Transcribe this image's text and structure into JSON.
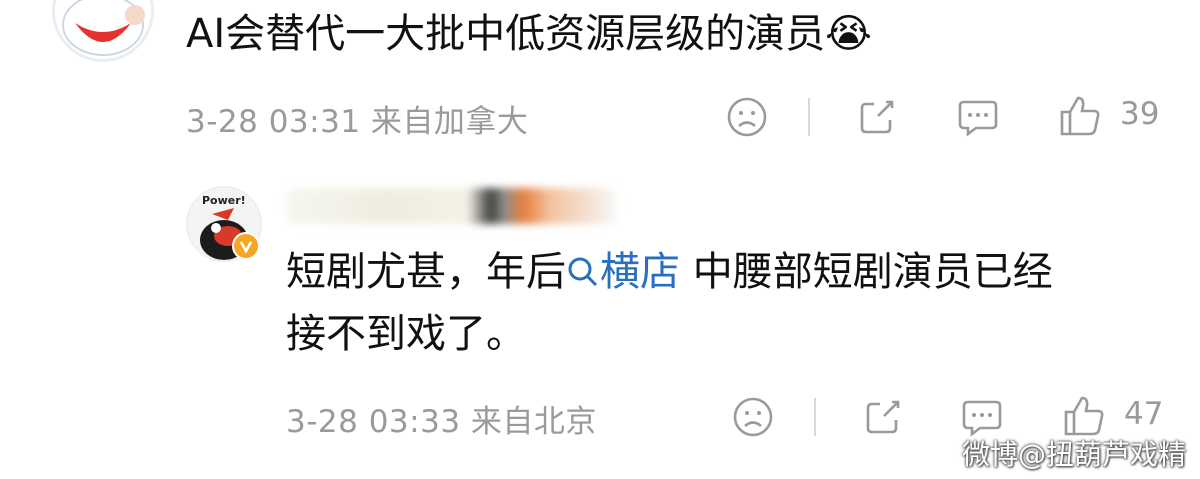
{
  "comment1": {
    "text": "AI会替代一大批中低资源层级的演员😭",
    "meta": "3-28 03:31 来自加拿大",
    "like_count": "39"
  },
  "comment2": {
    "avatar_label": "Power!",
    "text_before": "短剧尤甚，年后",
    "link_text": "横店",
    "text_after": " 中腰部短剧演员已经",
    "text_line2": "接不到戏了。",
    "meta": "3-28 03:33 来自北京",
    "like_count": "47"
  },
  "watermark": "微博@扭葫芦戏精",
  "icons": {
    "dislike": "sad-face-icon",
    "share": "share-icon",
    "comment": "comment-icon",
    "like": "thumbs-up-icon",
    "search": "search-icon",
    "verified": "verified-badge-icon"
  },
  "colors": {
    "link": "#2a6fbf",
    "meta": "#9a9a9a",
    "badge": "#f5a623"
  }
}
